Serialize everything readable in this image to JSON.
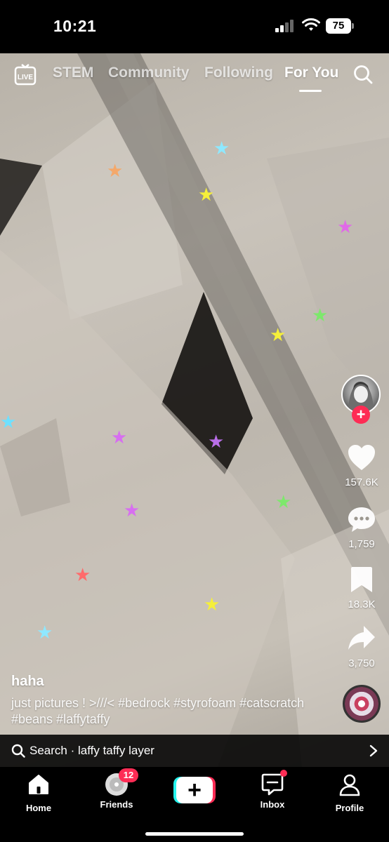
{
  "status_bar": {
    "time": "10:21",
    "battery": "75"
  },
  "top_nav": {
    "live_label": "LIVE",
    "tabs": [
      {
        "label": "STEM",
        "active": false
      },
      {
        "label": "Community",
        "active": false
      },
      {
        "label": "Following",
        "active": false
      },
      {
        "label": "For You",
        "active": true
      }
    ]
  },
  "actions": {
    "likes": "157.6K",
    "comments": "1,759",
    "bookmarks": "18.3K",
    "shares": "3,750",
    "follow_symbol": "+"
  },
  "post": {
    "username": "haha",
    "caption": "just pictures ! >///< #bedrock #styrofoam #catscratch #beans #laffytaffy"
  },
  "search_suggestion": {
    "text": "Search · laffy taffy layer"
  },
  "bottom_nav": {
    "home": "Home",
    "friends": "Friends",
    "friends_badge": "12",
    "create_symbol": "+",
    "inbox": "Inbox",
    "profile": "Profile"
  },
  "colors": {
    "accent": "#fe2c55",
    "cyan": "#25f4ee",
    "background": "#000000"
  }
}
